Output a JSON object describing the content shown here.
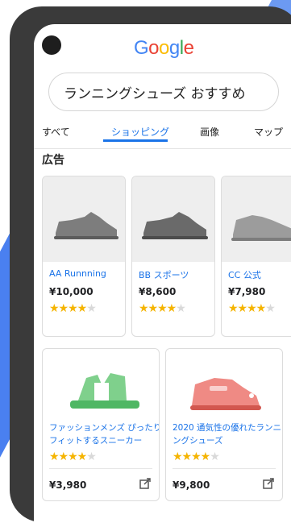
{
  "logo": [
    "G",
    "o",
    "o",
    "g",
    "l",
    "e"
  ],
  "logo_colors": [
    "#4285F4",
    "#EA4335",
    "#FBBC05",
    "#4285F4",
    "#34A853",
    "#EA4335"
  ],
  "search": {
    "query": "ランニングシューズ おすすめ"
  },
  "tabs": [
    {
      "label": "すべて"
    },
    {
      "label": "ショッピング",
      "active": true
    },
    {
      "label": "画像"
    },
    {
      "label": "マップ"
    }
  ],
  "ads_label": "広告",
  "small_cards": [
    {
      "name": "AA Runnning",
      "price": "¥10,000",
      "rating": 4,
      "shoe_color": "#7d7d7d"
    },
    {
      "name": "BB スポーツ",
      "price": "¥8,600",
      "rating": 4,
      "shoe_color": "#6a6a6a"
    },
    {
      "name": "CC 公式",
      "price": "¥7,980",
      "rating": 4,
      "shoe_color": "#9c9c9c"
    }
  ],
  "large_cards": [
    {
      "name": "ファッションメンズ ぴったりフィットするスニーカー",
      "price": "¥3,980",
      "rating": 4,
      "item": "sandal",
      "color": "#7fd08c"
    },
    {
      "name": "2020 通気性の優れたランニングシューズ",
      "price": "¥9,800",
      "rating": 4,
      "item": "shoe",
      "color": "#ef8a84"
    }
  ],
  "colors": {
    "accent": "#1a73e8",
    "star": "#f5b400"
  }
}
